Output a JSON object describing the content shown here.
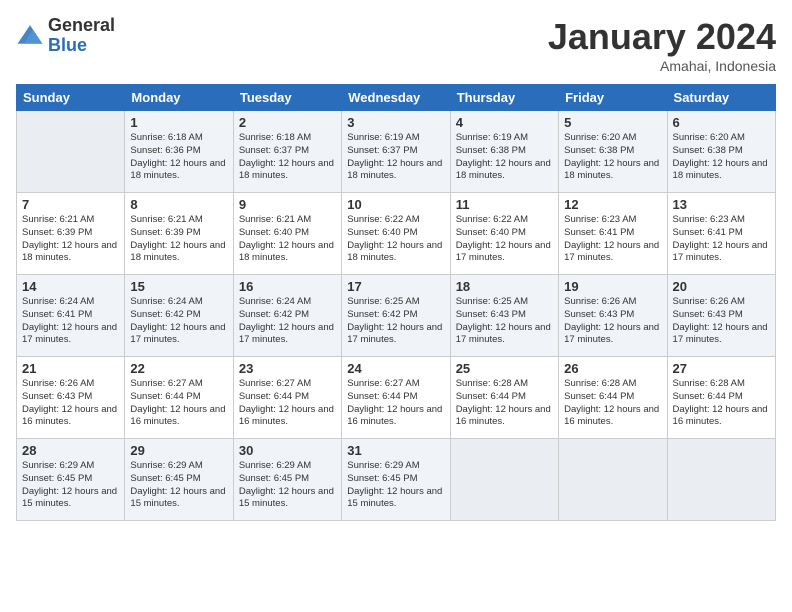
{
  "logo": {
    "general": "General",
    "blue": "Blue"
  },
  "title": "January 2024",
  "location": "Amahai, Indonesia",
  "days_header": [
    "Sunday",
    "Monday",
    "Tuesday",
    "Wednesday",
    "Thursday",
    "Friday",
    "Saturday"
  ],
  "weeks": [
    [
      {
        "day": "",
        "sunrise": "",
        "sunset": "",
        "daylight": ""
      },
      {
        "day": "1",
        "sunrise": "Sunrise: 6:18 AM",
        "sunset": "Sunset: 6:36 PM",
        "daylight": "Daylight: 12 hours and 18 minutes."
      },
      {
        "day": "2",
        "sunrise": "Sunrise: 6:18 AM",
        "sunset": "Sunset: 6:37 PM",
        "daylight": "Daylight: 12 hours and 18 minutes."
      },
      {
        "day": "3",
        "sunrise": "Sunrise: 6:19 AM",
        "sunset": "Sunset: 6:37 PM",
        "daylight": "Daylight: 12 hours and 18 minutes."
      },
      {
        "day": "4",
        "sunrise": "Sunrise: 6:19 AM",
        "sunset": "Sunset: 6:38 PM",
        "daylight": "Daylight: 12 hours and 18 minutes."
      },
      {
        "day": "5",
        "sunrise": "Sunrise: 6:20 AM",
        "sunset": "Sunset: 6:38 PM",
        "daylight": "Daylight: 12 hours and 18 minutes."
      },
      {
        "day": "6",
        "sunrise": "Sunrise: 6:20 AM",
        "sunset": "Sunset: 6:38 PM",
        "daylight": "Daylight: 12 hours and 18 minutes."
      }
    ],
    [
      {
        "day": "7",
        "sunrise": "Sunrise: 6:21 AM",
        "sunset": "Sunset: 6:39 PM",
        "daylight": "Daylight: 12 hours and 18 minutes."
      },
      {
        "day": "8",
        "sunrise": "Sunrise: 6:21 AM",
        "sunset": "Sunset: 6:39 PM",
        "daylight": "Daylight: 12 hours and 18 minutes."
      },
      {
        "day": "9",
        "sunrise": "Sunrise: 6:21 AM",
        "sunset": "Sunset: 6:40 PM",
        "daylight": "Daylight: 12 hours and 18 minutes."
      },
      {
        "day": "10",
        "sunrise": "Sunrise: 6:22 AM",
        "sunset": "Sunset: 6:40 PM",
        "daylight": "Daylight: 12 hours and 18 minutes."
      },
      {
        "day": "11",
        "sunrise": "Sunrise: 6:22 AM",
        "sunset": "Sunset: 6:40 PM",
        "daylight": "Daylight: 12 hours and 17 minutes."
      },
      {
        "day": "12",
        "sunrise": "Sunrise: 6:23 AM",
        "sunset": "Sunset: 6:41 PM",
        "daylight": "Daylight: 12 hours and 17 minutes."
      },
      {
        "day": "13",
        "sunrise": "Sunrise: 6:23 AM",
        "sunset": "Sunset: 6:41 PM",
        "daylight": "Daylight: 12 hours and 17 minutes."
      }
    ],
    [
      {
        "day": "14",
        "sunrise": "Sunrise: 6:24 AM",
        "sunset": "Sunset: 6:41 PM",
        "daylight": "Daylight: 12 hours and 17 minutes."
      },
      {
        "day": "15",
        "sunrise": "Sunrise: 6:24 AM",
        "sunset": "Sunset: 6:42 PM",
        "daylight": "Daylight: 12 hours and 17 minutes."
      },
      {
        "day": "16",
        "sunrise": "Sunrise: 6:24 AM",
        "sunset": "Sunset: 6:42 PM",
        "daylight": "Daylight: 12 hours and 17 minutes."
      },
      {
        "day": "17",
        "sunrise": "Sunrise: 6:25 AM",
        "sunset": "Sunset: 6:42 PM",
        "daylight": "Daylight: 12 hours and 17 minutes."
      },
      {
        "day": "18",
        "sunrise": "Sunrise: 6:25 AM",
        "sunset": "Sunset: 6:43 PM",
        "daylight": "Daylight: 12 hours and 17 minutes."
      },
      {
        "day": "19",
        "sunrise": "Sunrise: 6:26 AM",
        "sunset": "Sunset: 6:43 PM",
        "daylight": "Daylight: 12 hours and 17 minutes."
      },
      {
        "day": "20",
        "sunrise": "Sunrise: 6:26 AM",
        "sunset": "Sunset: 6:43 PM",
        "daylight": "Daylight: 12 hours and 17 minutes."
      }
    ],
    [
      {
        "day": "21",
        "sunrise": "Sunrise: 6:26 AM",
        "sunset": "Sunset: 6:43 PM",
        "daylight": "Daylight: 12 hours and 16 minutes."
      },
      {
        "day": "22",
        "sunrise": "Sunrise: 6:27 AM",
        "sunset": "Sunset: 6:44 PM",
        "daylight": "Daylight: 12 hours and 16 minutes."
      },
      {
        "day": "23",
        "sunrise": "Sunrise: 6:27 AM",
        "sunset": "Sunset: 6:44 PM",
        "daylight": "Daylight: 12 hours and 16 minutes."
      },
      {
        "day": "24",
        "sunrise": "Sunrise: 6:27 AM",
        "sunset": "Sunset: 6:44 PM",
        "daylight": "Daylight: 12 hours and 16 minutes."
      },
      {
        "day": "25",
        "sunrise": "Sunrise: 6:28 AM",
        "sunset": "Sunset: 6:44 PM",
        "daylight": "Daylight: 12 hours and 16 minutes."
      },
      {
        "day": "26",
        "sunrise": "Sunrise: 6:28 AM",
        "sunset": "Sunset: 6:44 PM",
        "daylight": "Daylight: 12 hours and 16 minutes."
      },
      {
        "day": "27",
        "sunrise": "Sunrise: 6:28 AM",
        "sunset": "Sunset: 6:44 PM",
        "daylight": "Daylight: 12 hours and 16 minutes."
      }
    ],
    [
      {
        "day": "28",
        "sunrise": "Sunrise: 6:29 AM",
        "sunset": "Sunset: 6:45 PM",
        "daylight": "Daylight: 12 hours and 15 minutes."
      },
      {
        "day": "29",
        "sunrise": "Sunrise: 6:29 AM",
        "sunset": "Sunset: 6:45 PM",
        "daylight": "Daylight: 12 hours and 15 minutes."
      },
      {
        "day": "30",
        "sunrise": "Sunrise: 6:29 AM",
        "sunset": "Sunset: 6:45 PM",
        "daylight": "Daylight: 12 hours and 15 minutes."
      },
      {
        "day": "31",
        "sunrise": "Sunrise: 6:29 AM",
        "sunset": "Sunset: 6:45 PM",
        "daylight": "Daylight: 12 hours and 15 minutes."
      },
      {
        "day": "",
        "sunrise": "",
        "sunset": "",
        "daylight": ""
      },
      {
        "day": "",
        "sunrise": "",
        "sunset": "",
        "daylight": ""
      },
      {
        "day": "",
        "sunrise": "",
        "sunset": "",
        "daylight": ""
      }
    ]
  ]
}
